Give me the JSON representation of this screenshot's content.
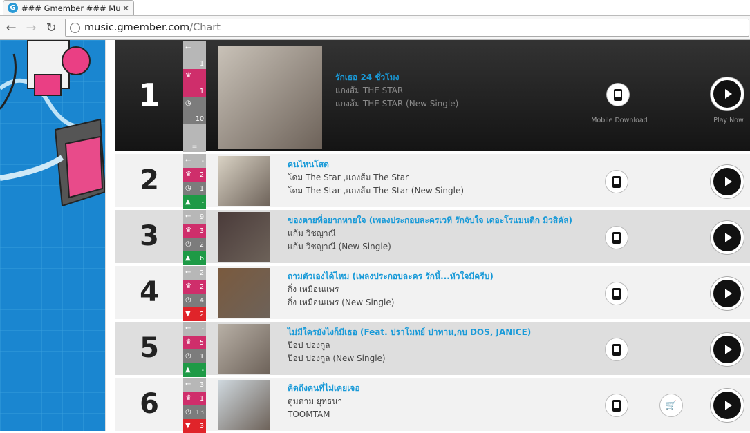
{
  "browser": {
    "tab_title": "### Gmember ### Music",
    "tab_favicon": "G",
    "url_host": "music.gmember.com",
    "url_path": "/Chart"
  },
  "labels": {
    "mobile_download": "Mobile Download",
    "play_now": "Play Now"
  },
  "colors": {
    "song_title": "#199ad8",
    "peak": "#cf2e6b",
    "up": "#1e9a46",
    "down": "#e0242a"
  },
  "rows": [
    {
      "rank": "1",
      "prev": "1",
      "peak": "1",
      "weeks": "10",
      "move": "=",
      "move_dir": "same",
      "song": "รักเธอ 24 ชั่วโมง",
      "artist": "แกงส้ม THE STAR",
      "album": "แกงส้ม THE STAR (New Single)",
      "cart": false
    },
    {
      "rank": "2",
      "prev": "-",
      "peak": "2",
      "weeks": "1",
      "move": "-",
      "move_dir": "up",
      "song": "คนไหนโสด",
      "artist": "โดม The Star ,แกงส้ม The Star",
      "album": "โดม The Star ,แกงส้ม The Star (New Single)",
      "cart": false
    },
    {
      "rank": "3",
      "prev": "9",
      "peak": "3",
      "weeks": "2",
      "move": "6",
      "move_dir": "up",
      "song": "ของตายที่อยากหายใจ (เพลงประกอบละครเวที รักจับใจ เดอะโรแมนติก มิวสิคัล)",
      "artist": "แก้ม วิชญาณี",
      "album": "แก้ม วิชญาณี (New Single)",
      "cart": false
    },
    {
      "rank": "4",
      "prev": "2",
      "peak": "2",
      "weeks": "4",
      "move": "2",
      "move_dir": "down",
      "song": "ถามตัวเองได้ไหม (เพลงประกอบละคร รักนี้...หัวใจมีครีบ)",
      "artist": "กิ่ง เหมือนแพร",
      "album": "กิ่ง เหมือนแพร (New Single)",
      "cart": false
    },
    {
      "rank": "5",
      "prev": "-",
      "peak": "5",
      "weeks": "1",
      "move": "-",
      "move_dir": "up",
      "song": "ไม่มีใครยังไงก็มีเธอ (Feat. ปราโมทย์ ปาทาน,กบ DOS, JANICE)",
      "artist": "ป๊อป ปองกูล",
      "album": "ป๊อป ปองกูล (New Single)",
      "cart": false
    },
    {
      "rank": "6",
      "prev": "3",
      "peak": "1",
      "weeks": "13",
      "move": "3",
      "move_dir": "down",
      "song": "คิดถึงคนที่ไม่เคยเจอ",
      "artist": "ตูมตาม ยุทธนา",
      "album": "TOOMTAM",
      "cart": true
    }
  ]
}
